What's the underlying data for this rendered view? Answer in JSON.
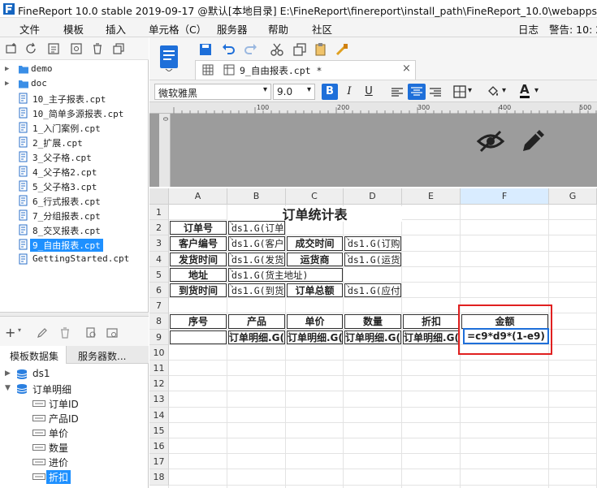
{
  "window": {
    "title": "FineReport 10.0 stable 2019-09-17 @默认[本地目录]     E:\\FineReport\\finereport\\install_path\\FineReport_10.0\\webapps\\webr"
  },
  "menu": {
    "items": [
      "文件",
      "模板",
      "插入",
      "单元格（C）",
      "服务器",
      "帮助",
      "社区"
    ],
    "right": [
      "日志",
      "警告: 10: 2"
    ]
  },
  "file_tree": [
    {
      "type": "folder",
      "label": "demo"
    },
    {
      "type": "folder",
      "label": "doc"
    },
    {
      "type": "file",
      "label": "10_主子报表.cpt"
    },
    {
      "type": "file",
      "label": "10_简单多源报表.cpt"
    },
    {
      "type": "file",
      "label": "1_入门案例.cpt"
    },
    {
      "type": "file",
      "label": "2_扩展.cpt"
    },
    {
      "type": "file",
      "label": "3_父子格.cpt"
    },
    {
      "type": "file",
      "label": "4_父子格2.cpt"
    },
    {
      "type": "file",
      "label": "5_父子格3.cpt"
    },
    {
      "type": "file",
      "label": "6_行式报表.cpt"
    },
    {
      "type": "file",
      "label": "7_分组报表.cpt"
    },
    {
      "type": "file",
      "label": "8_交叉报表.cpt"
    },
    {
      "type": "file",
      "label": "9_自由报表.cpt",
      "selected": true
    },
    {
      "type": "file",
      "label": "GettingStarted.cpt"
    }
  ],
  "dataset_panel": {
    "tabs": [
      "模板数据集",
      "服务器数..."
    ],
    "tree": [
      {
        "level": 0,
        "label": "ds1",
        "type": "db"
      },
      {
        "level": 0,
        "label": "订单明细",
        "type": "db",
        "expanded": true
      },
      {
        "level": 1,
        "label": "订单ID"
      },
      {
        "level": 1,
        "label": "产品ID"
      },
      {
        "level": 1,
        "label": "单价"
      },
      {
        "level": 1,
        "label": "数量"
      },
      {
        "level": 1,
        "label": "进价"
      },
      {
        "level": 1,
        "label": "折扣",
        "selected": true
      }
    ]
  },
  "editor_tab": {
    "label": "9_自由报表.cpt *"
  },
  "format_bar": {
    "font": "微软雅黑",
    "size": "9.0",
    "bold": "B",
    "italic": "I",
    "underline": "U",
    "font_color_letter": "A"
  },
  "ruler_ticks": [
    "100",
    "200",
    "300",
    "400",
    "500"
  ],
  "vruler_ticks": [
    "0"
  ],
  "grid": {
    "columns": [
      "A",
      "B",
      "C",
      "D",
      "E",
      "F",
      "G"
    ],
    "rows": [
      "1",
      "2",
      "3",
      "4",
      "5",
      "6",
      "7",
      "8",
      "9",
      "10",
      "11",
      "12",
      "13",
      "14",
      "15",
      "16",
      "17",
      "18"
    ],
    "title": "订单统计表",
    "cells": {
      "r2a": "订单号",
      "r2b": "ds1.G(订单",
      "r3a": "客户编号",
      "r3b": "ds1.G(客户",
      "r3c": "成交时间",
      "r3d": "ds1.G(订购",
      "r4a": "发货时间",
      "r4b": "ds1.G(发货",
      "r4c": "运货商",
      "r4d": "ds1.G(运货",
      "r5a": "地址",
      "r5b": "ds1.G(货主地址)",
      "r6a": "到货时间",
      "r6b": "ds1.G(到货",
      "r6c": "订单总额",
      "r6d": "ds1.G(应付",
      "r8a": "序号",
      "r8b": "产品",
      "r8c": "单价",
      "r8d": "数量",
      "r8e": "折扣",
      "r8f": "金额",
      "r9b": "订单明细.G(",
      "r9c": "订单明细.G(",
      "r9d": "订单明细.G(",
      "r9e": "订单明细.G(",
      "r9f": "=c9*d9*(1-e9)"
    }
  },
  "colors": {
    "accent": "#1e90ff",
    "highlight": "#e02020",
    "selection": "#1e6fd9"
  }
}
